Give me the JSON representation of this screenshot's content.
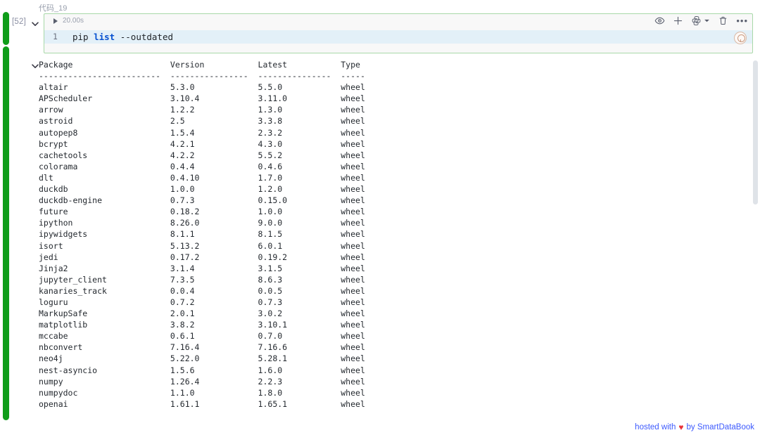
{
  "cell": {
    "title": "代码_19",
    "execution_count": "[52]",
    "execution_time": "20.00s",
    "line_number": "1",
    "code_prefix": "pip ",
    "code_keyword": "list",
    "code_suffix": " --outdated"
  },
  "toolbar": {
    "items": [
      {
        "name": "eye-icon",
        "label": "Preview"
      },
      {
        "name": "plus-icon",
        "label": "Add"
      },
      {
        "name": "python-kernel-icon",
        "label": "Python"
      },
      {
        "name": "chevron-down-icon",
        "label": "Kernel menu"
      },
      {
        "name": "trash-icon",
        "label": "Delete"
      },
      {
        "name": "more-options-icon",
        "label": "More"
      }
    ],
    "more_glyph": "•••"
  },
  "output": {
    "headers": [
      "Package",
      "Version",
      "Latest",
      "Type"
    ],
    "separators": [
      "-------------------------",
      "----------------",
      "---------------",
      "-----"
    ],
    "rows": [
      [
        "altair",
        "5.3.0",
        "5.5.0",
        "wheel"
      ],
      [
        "APScheduler",
        "3.10.4",
        "3.11.0",
        "wheel"
      ],
      [
        "arrow",
        "1.2.2",
        "1.3.0",
        "wheel"
      ],
      [
        "astroid",
        "2.5",
        "3.3.8",
        "wheel"
      ],
      [
        "autopep8",
        "1.5.4",
        "2.3.2",
        "wheel"
      ],
      [
        "bcrypt",
        "4.2.1",
        "4.3.0",
        "wheel"
      ],
      [
        "cachetools",
        "4.2.2",
        "5.5.2",
        "wheel"
      ],
      [
        "colorama",
        "0.4.4",
        "0.4.6",
        "wheel"
      ],
      [
        "dlt",
        "0.4.10",
        "1.7.0",
        "wheel"
      ],
      [
        "duckdb",
        "1.0.0",
        "1.2.0",
        "wheel"
      ],
      [
        "duckdb-engine",
        "0.7.3",
        "0.15.0",
        "wheel"
      ],
      [
        "future",
        "0.18.2",
        "1.0.0",
        "wheel"
      ],
      [
        "ipython",
        "8.26.0",
        "9.0.0",
        "wheel"
      ],
      [
        "ipywidgets",
        "8.1.1",
        "8.1.5",
        "wheel"
      ],
      [
        "isort",
        "5.13.2",
        "6.0.1",
        "wheel"
      ],
      [
        "jedi",
        "0.17.2",
        "0.19.2",
        "wheel"
      ],
      [
        "Jinja2",
        "3.1.4",
        "3.1.5",
        "wheel"
      ],
      [
        "jupyter_client",
        "7.3.5",
        "8.6.3",
        "wheel"
      ],
      [
        "kanaries_track",
        "0.0.4",
        "0.0.5",
        "wheel"
      ],
      [
        "loguru",
        "0.7.2",
        "0.7.3",
        "wheel"
      ],
      [
        "MarkupSafe",
        "2.0.1",
        "3.0.2",
        "wheel"
      ],
      [
        "matplotlib",
        "3.8.2",
        "3.10.1",
        "wheel"
      ],
      [
        "mccabe",
        "0.6.1",
        "0.7.0",
        "wheel"
      ],
      [
        "nbconvert",
        "7.16.4",
        "7.16.6",
        "wheel"
      ],
      [
        "neo4j",
        "5.22.0",
        "5.28.1",
        "wheel"
      ],
      [
        "nest-asyncio",
        "1.5.6",
        "1.6.0",
        "wheel"
      ],
      [
        "numpy",
        "1.26.4",
        "2.2.3",
        "wheel"
      ],
      [
        "numpydoc",
        "1.1.0",
        "1.8.0",
        "wheel"
      ],
      [
        "openai",
        "1.61.1",
        "1.65.1",
        "wheel"
      ]
    ]
  },
  "footer": {
    "prefix": "hosted with",
    "heart": "♥",
    "suffix": "by SmartDataBook"
  },
  "colors": {
    "run_indicator": "#0f9d1a",
    "cell_border": "#a8d8a8",
    "code_highlight": "#e3f0f8",
    "keyword": "#0550d0",
    "footer_link": "#3d5afe",
    "heart": "#e8333a"
  }
}
